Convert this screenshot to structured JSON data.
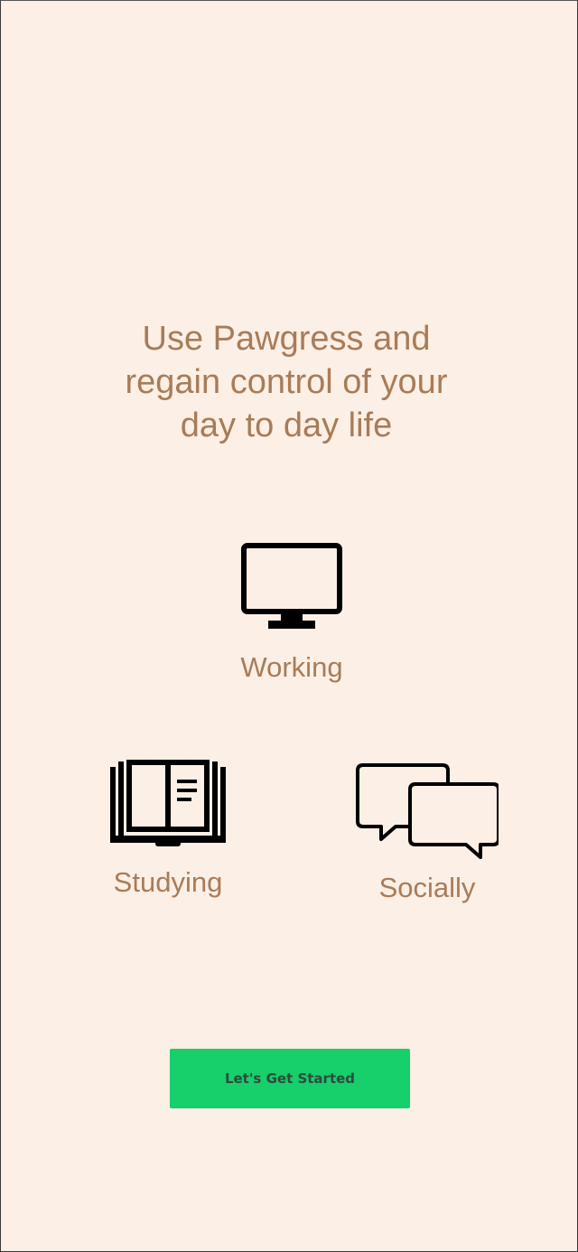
{
  "headline": {
    "line1": "Use Pawgress and",
    "line2": "regain control of your",
    "line3": "day to day life"
  },
  "features": {
    "working": {
      "label": "Working",
      "icon": "monitor-icon"
    },
    "studying": {
      "label": "Studying",
      "icon": "open-book-icon"
    },
    "socially": {
      "label": "Socially",
      "icon": "chat-bubbles-icon"
    }
  },
  "cta": {
    "label": "Let's Get Started"
  },
  "colors": {
    "background": "#fcefe5",
    "text_accent": "#a87c58",
    "button": "#17cf6b",
    "button_text": "#2f4a3d"
  }
}
